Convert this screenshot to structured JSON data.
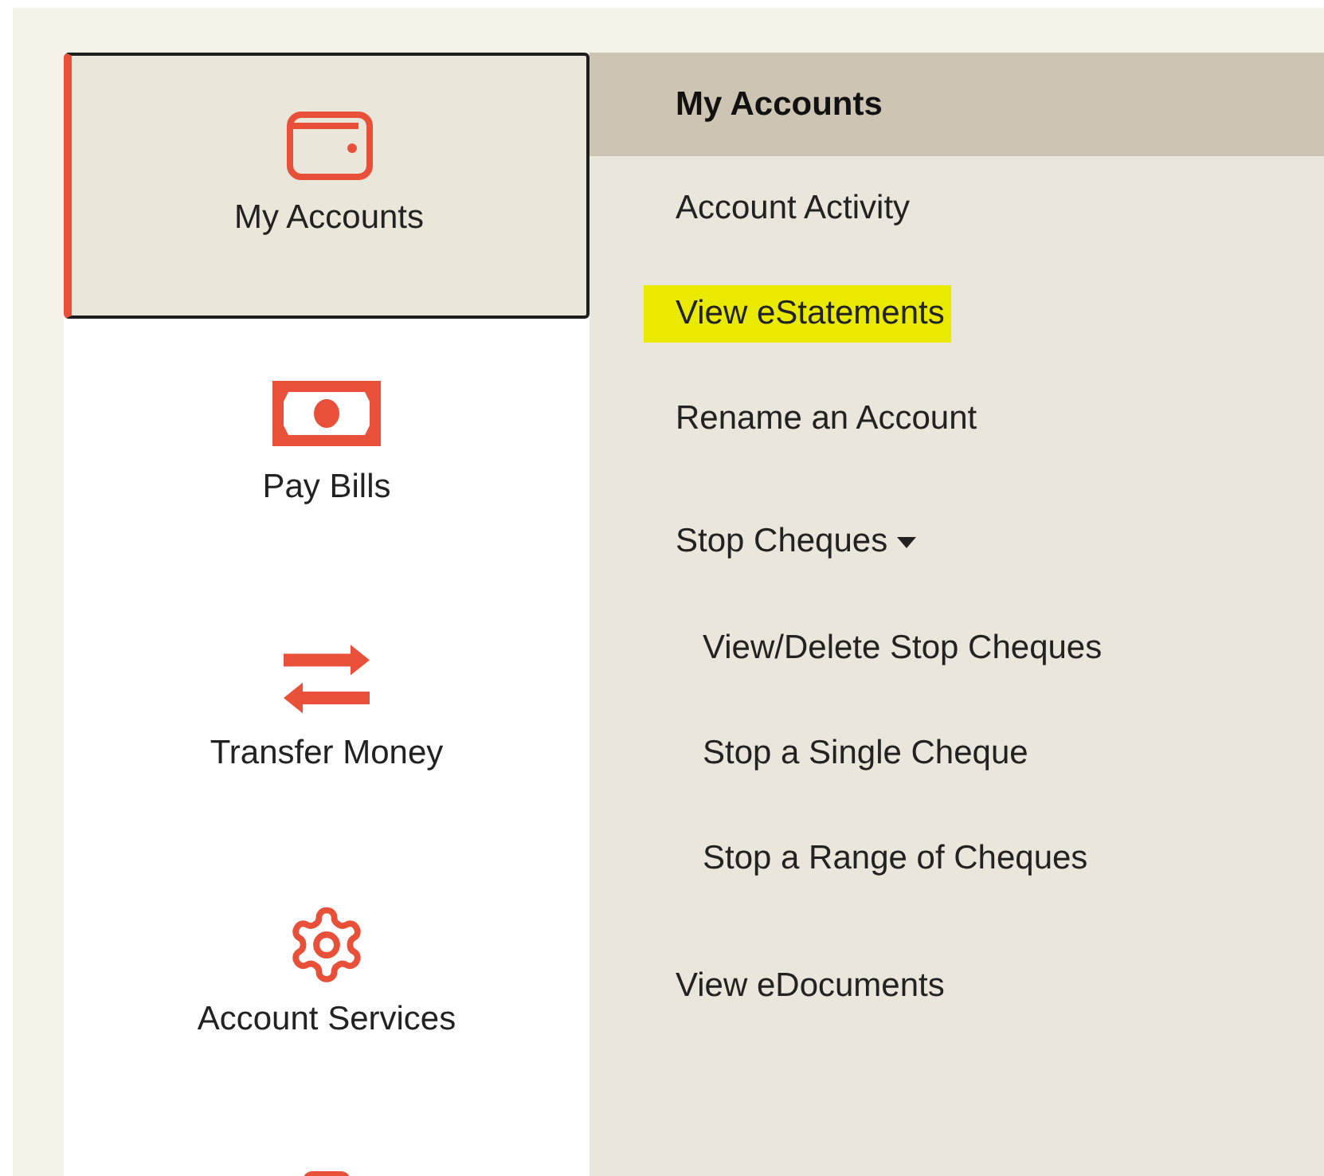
{
  "sidebar": {
    "items": [
      {
        "label": "My Accounts",
        "selected": true
      },
      {
        "label": "Pay Bills",
        "selected": false
      },
      {
        "label": "Transfer Money",
        "selected": false
      },
      {
        "label": "Account Services",
        "selected": false
      },
      {
        "selected": false
      }
    ]
  },
  "submenu": {
    "title": "My Accounts",
    "items": [
      {
        "label": "Account Activity",
        "highlighted": false
      },
      {
        "label": "View eStatements",
        "highlighted": true
      },
      {
        "label": "Rename an Account",
        "highlighted": false
      },
      {
        "label": "Stop Cheques",
        "expanded": true,
        "highlighted": false,
        "children": [
          {
            "label": "View/Delete Stop Cheques",
            "highlighted": false
          },
          {
            "label": "Stop a Single Cheque",
            "highlighted": false
          },
          {
            "label": "Stop a Range of Cheques",
            "highlighted": false
          }
        ]
      },
      {
        "label": "View eDocuments",
        "highlighted": false
      }
    ]
  }
}
